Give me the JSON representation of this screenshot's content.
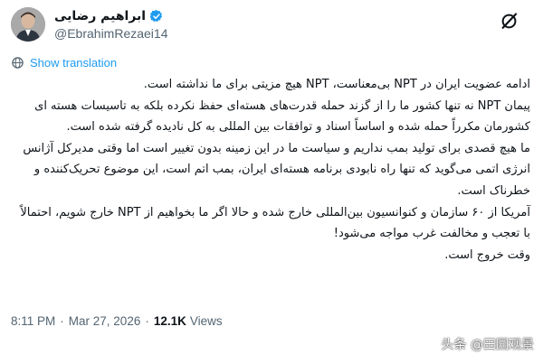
{
  "author": {
    "display_name": "ابراهیم رضایی",
    "handle": "@EbrahimRezaei14",
    "verified_icon": "verified-badge-icon",
    "avatar_icon": "avatar"
  },
  "toolbar": {
    "grok_icon": "grok-icon"
  },
  "translate": {
    "label": "Show translation",
    "icon": "globe-icon"
  },
  "tweet": {
    "paragraphs": [
      "ادامه عضویت ایران در NPT بی‌معناست، NPT هیچ مزیتی برای ما نداشته است.",
      "پیمان NPT نه تنها کشور ما را از گزند حمله قدرت‌های هسته‌ای حفظ نکرده بلکه به تاسیسات هسته ای کشورمان مکرراً حمله شده و اساساً اسناد و توافقات بین المللی به کل نادیده گرفته شده است.",
      "ما هیچ قصدی برای تولید بمب نداریم و سیاست ما در این زمینه بدون تغییر است اما وقتی مدیرکل آژانس انرژی اتمی می‌گوید که تنها راه نابودی برنامه هسته‌ای ایران، بمب اتم است، این موضوع تحریک‌کننده و خطرناک است.",
      "آمریکا از ۶۰ سازمان و کنوانسیون بین‌المللی خارج شده و حالا اگر ما بخواهیم از NPT خارج شویم، احتمالاً با تعجب و مخالفت غرب مواجه می‌شود!",
      "وقت خروج است."
    ]
  },
  "meta": {
    "time": "8:11 PM",
    "separator": "·",
    "date": "Mar 27, 2026",
    "views_count": "12.1K",
    "views_label": "Views"
  },
  "watermark": "头条 @田园观景",
  "colors": {
    "accent": "#1d9bf0",
    "muted": "#536471",
    "text": "#0f1419"
  }
}
